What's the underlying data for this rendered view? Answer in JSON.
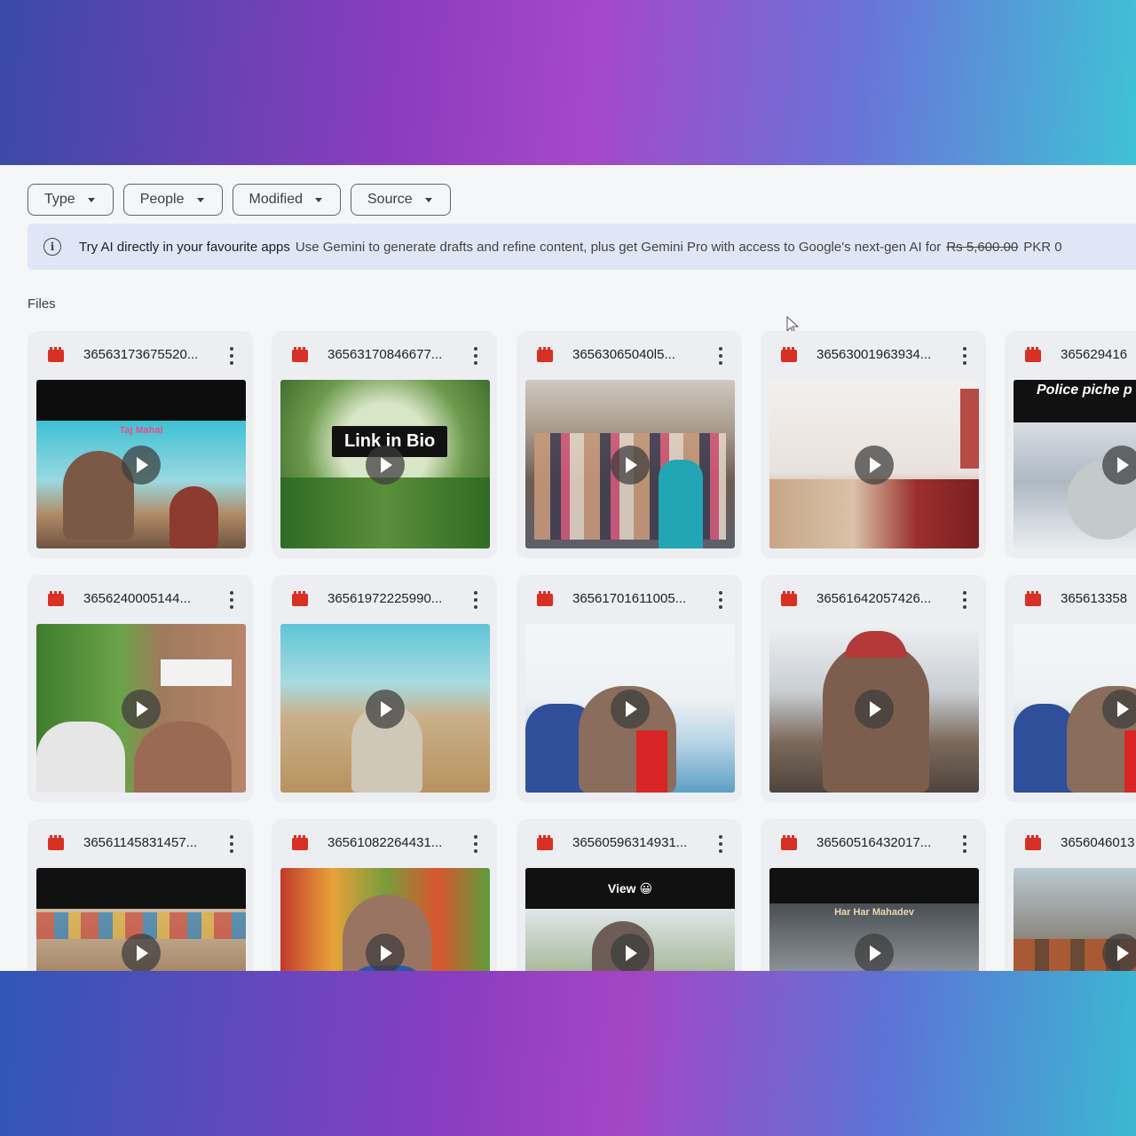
{
  "filters": [
    {
      "label": "Type"
    },
    {
      "label": "People"
    },
    {
      "label": "Modified"
    },
    {
      "label": "Source"
    }
  ],
  "banner": {
    "title": "Try AI directly in your favourite apps",
    "body": "Use Gemini to generate drafts and refine content, plus get Gemini Pro with access to Google's next-gen AI for",
    "old_price": "Rs 5,600.00",
    "currency": "PKR 0"
  },
  "section_label": "Files",
  "files": [
    {
      "name": "36563173675520...",
      "caption": "Taj Mahal"
    },
    {
      "name": "36563170846677...",
      "caption": "Link in Bio"
    },
    {
      "name": "36563065040l5...",
      "caption": ""
    },
    {
      "name": "36563001963934...",
      "caption": ""
    },
    {
      "name": "365629416",
      "caption": "Police piche p bahi"
    },
    {
      "name": "3656240005144...",
      "caption": ""
    },
    {
      "name": "36561972225990...",
      "caption": ""
    },
    {
      "name": "36561701611005...",
      "caption": ""
    },
    {
      "name": "36561642057426...",
      "caption": ""
    },
    {
      "name": "365613358",
      "caption": ""
    },
    {
      "name": "36561145831457...",
      "caption": ""
    },
    {
      "name": "36561082264431...",
      "caption": ""
    },
    {
      "name": "36560596314931...",
      "caption": "View 😀"
    },
    {
      "name": "36560516432017...",
      "caption": "Har Har Mahadev"
    },
    {
      "name": "3656046013",
      "caption": ""
    }
  ]
}
